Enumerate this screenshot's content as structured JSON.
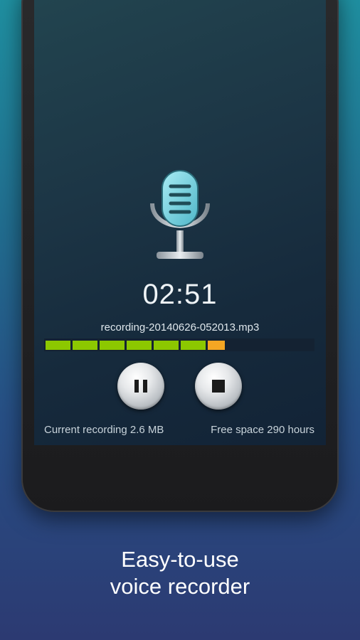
{
  "recorder": {
    "timer": "02:51",
    "filename": "recording-20140626-052013.mp3",
    "level_meter": {
      "segments_total": 10,
      "segments_lit": 7,
      "segment_colors": [
        "#8cc800",
        "#8cc800",
        "#8cc800",
        "#8cc800",
        "#8cc800",
        "#8cc800",
        "#f5a623"
      ]
    },
    "current_recording": "Current recording 2.6 MB",
    "free_space": "Free space 290 hours"
  },
  "controls": {
    "pause_icon": "pause-icon",
    "stop_icon": "stop-icon",
    "mic_icon": "microphone-icon"
  },
  "promo": {
    "line1": "Easy-to-use",
    "line2": "voice recorder"
  },
  "colors": {
    "meter_green": "#8cc800",
    "meter_orange": "#f5a623",
    "mic_accent": "#7ad3e0"
  }
}
